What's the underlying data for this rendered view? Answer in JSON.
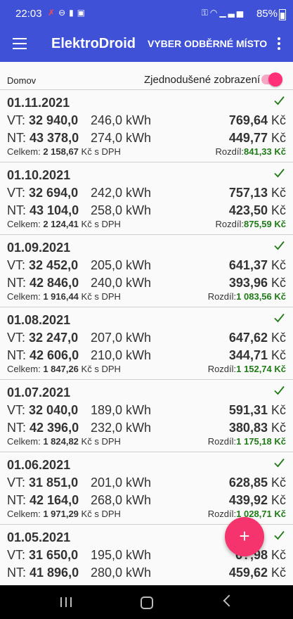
{
  "status_bar": {
    "time": "22:03",
    "battery": "85%"
  },
  "app_bar": {
    "title": "ElektroDroid",
    "select_place_label": "VYBER ODBĚRNÉ MÍSTO"
  },
  "subheader": {
    "place_label": "Domov",
    "simplified_view_label": "Zjednodušené zobrazení",
    "simplified_view_on": true
  },
  "labels": {
    "vt": "VT:",
    "nt": "NT:",
    "total": "Celkem:",
    "total_suffix": "Kč s DPH",
    "diff": "Rozdíl:",
    "currency": "Kč"
  },
  "fab_label": "+",
  "colors": {
    "primary": "#3f51d6",
    "accent": "#f5336d",
    "diff": "#1e7b16"
  },
  "entries": [
    {
      "date": "01.11.2021",
      "vt_meter": "32 940,0",
      "vt_kwh": "246,0 kWh",
      "vt_price": "769,64",
      "nt_meter": "43 378,0",
      "nt_kwh": "274,0 kWh",
      "nt_price": "449,77",
      "total": "2 158,67",
      "diff": "841,33 Kč"
    },
    {
      "date": "01.10.2021",
      "vt_meter": "32 694,0",
      "vt_kwh": "242,0 kWh",
      "vt_price": "757,13",
      "nt_meter": "43 104,0",
      "nt_kwh": "258,0 kWh",
      "nt_price": "423,50",
      "total": "2 124,41",
      "diff": "875,59 Kč"
    },
    {
      "date": "01.09.2021",
      "vt_meter": "32 452,0",
      "vt_kwh": "205,0 kWh",
      "vt_price": "641,37",
      "nt_meter": "42 846,0",
      "nt_kwh": "240,0 kWh",
      "nt_price": "393,96",
      "total": "1 916,44",
      "diff": "1 083,56 Kč"
    },
    {
      "date": "01.08.2021",
      "vt_meter": "32 247,0",
      "vt_kwh": "207,0 kWh",
      "vt_price": "647,62",
      "nt_meter": "42 606,0",
      "nt_kwh": "210,0 kWh",
      "nt_price": "344,71",
      "total": "1 847,26",
      "diff": "1 152,74 Kč"
    },
    {
      "date": "01.07.2021",
      "vt_meter": "32 040,0",
      "vt_kwh": "189,0 kWh",
      "vt_price": "591,31",
      "nt_meter": "42 396,0",
      "nt_kwh": "232,0 kWh",
      "nt_price": "380,83",
      "total": "1 824,82",
      "diff": "1 175,18 Kč"
    },
    {
      "date": "01.06.2021",
      "vt_meter": "31 851,0",
      "vt_kwh": "201,0 kWh",
      "vt_price": "628,85",
      "nt_meter": "42 164,0",
      "nt_kwh": "268,0 kWh",
      "nt_price": "439,92",
      "total": "1 971,29",
      "diff": "1 028,71 Kč"
    },
    {
      "date": "01.05.2021",
      "vt_meter": "31 650,0",
      "vt_kwh": "195,0 kWh",
      "vt_price": "6?,98",
      "nt_meter": "41 896,0",
      "nt_kwh": "280,0 kWh",
      "nt_price": "459,62",
      "total": "",
      "diff": ""
    }
  ]
}
